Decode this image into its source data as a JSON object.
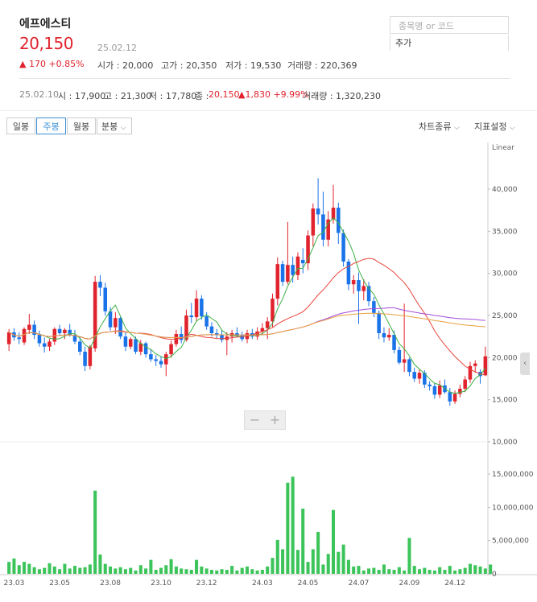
{
  "header": {
    "stock_name": "에프에스티",
    "price": "20,150",
    "date": "25.02.12",
    "change": "▲ 170 +0.85%",
    "open": "시가 : 20,000",
    "high": "고가 : 20,350",
    "low": "저가 : 19,530",
    "volume": "거래량 : 220,369"
  },
  "search": {
    "placeholder": "종목명 or 코드",
    "add_label": "추가"
  },
  "day_info": {
    "date": "25.02.10",
    "open": "시 : 17,900",
    "high": "고 : 21,300",
    "low": "저 : 17,780",
    "close_label": "종 :",
    "close_value": "20,150",
    "change": "▲1,830 +9.99%",
    "volume": "거래량 : 1,320,230"
  },
  "period_buttons": [
    "일봉",
    "주봉",
    "월봉",
    "분봉"
  ],
  "active_period": "주봉",
  "right_menu": {
    "chart_type": "차트종류",
    "indicator": "지표설정"
  },
  "zoom": {
    "minus": "−",
    "plus": "+"
  },
  "colors": {
    "up": "#e0232c",
    "down": "#1a73e8",
    "volume": "#3cc45a",
    "ma5": "#3cb043",
    "ma20": "#e8453c",
    "ma60": "#a34cd8",
    "ma120": "#e8a03c"
  },
  "chart_data": {
    "type": "candlestick",
    "scale_label": "Linear",
    "price_ylim": [
      10000,
      42000
    ],
    "price_ticks": [
      "40,000",
      "35,000",
      "30,000",
      "25,000",
      "20,000",
      "15,000",
      "10,000"
    ],
    "volume_ylim": [
      0,
      16000000
    ],
    "volume_ticks": [
      "15,000,000",
      "10,000,000",
      "5,000,000",
      "0"
    ],
    "x_labels": [
      "23.03",
      "23.05",
      "23.08",
      "23.10",
      "23.12",
      "24.03",
      "24.05",
      "24.07",
      "24.09",
      "24.12"
    ],
    "candles": [
      [
        21600,
        23400,
        20800,
        23000
      ],
      [
        23000,
        23500,
        22000,
        22400
      ],
      [
        22400,
        23000,
        21600,
        22200
      ],
      [
        21800,
        23600,
        21500,
        23400
      ],
      [
        23300,
        25200,
        22800,
        23900
      ],
      [
        23900,
        24400,
        22200,
        22700
      ],
      [
        22700,
        23200,
        21300,
        21700
      ],
      [
        21700,
        22400,
        20600,
        21300
      ],
      [
        21300,
        22200,
        20800,
        21900
      ],
      [
        21900,
        23600,
        21500,
        23400
      ],
      [
        23400,
        23900,
        22600,
        22900
      ],
      [
        22900,
        23500,
        22200,
        23300
      ],
      [
        23300,
        24000,
        22500,
        22700
      ],
      [
        22700,
        23300,
        21600,
        21900
      ],
      [
        21900,
        22500,
        20300,
        20700
      ],
      [
        20700,
        21300,
        18400,
        19000
      ],
      [
        19000,
        21500,
        18600,
        21300
      ],
      [
        21100,
        29700,
        20700,
        29000
      ],
      [
        29000,
        29800,
        27300,
        28300
      ],
      [
        28300,
        28900,
        25000,
        25500
      ],
      [
        25500,
        26000,
        23200,
        23600
      ],
      [
        23600,
        25400,
        22800,
        24700
      ],
      [
        24700,
        24900,
        22200,
        22500
      ],
      [
        22500,
        23000,
        20800,
        21300
      ],
      [
        21300,
        22400,
        21000,
        22200
      ],
      [
        22200,
        22500,
        20400,
        20700
      ],
      [
        20700,
        22100,
        20300,
        21700
      ],
      [
        21700,
        21900,
        20000,
        20400
      ],
      [
        20400,
        21000,
        19500,
        19800
      ],
      [
        19800,
        20300,
        19000,
        19600
      ],
      [
        19600,
        20100,
        18800,
        19200
      ],
      [
        19200,
        20700,
        17800,
        20400
      ],
      [
        20400,
        22000,
        20000,
        21600
      ],
      [
        21600,
        23300,
        21300,
        22800
      ],
      [
        22800,
        23700,
        21700,
        22100
      ],
      [
        22100,
        25700,
        21900,
        25000
      ],
      [
        25000,
        26500,
        24100,
        24800
      ],
      [
        24800,
        28000,
        24300,
        27000
      ],
      [
        27000,
        27400,
        24500,
        24900
      ],
      [
        24900,
        25400,
        23300,
        23700
      ],
      [
        23700,
        24200,
        22500,
        22900
      ],
      [
        22900,
        23400,
        22300,
        22700
      ],
      [
        22700,
        23200,
        21800,
        22100
      ],
      [
        22100,
        23000,
        20300,
        22500
      ],
      [
        22500,
        23300,
        21800,
        22900
      ],
      [
        22900,
        23600,
        22400,
        22600
      ],
      [
        22600,
        23100,
        21900,
        22200
      ],
      [
        22200,
        23300,
        21700,
        22900
      ],
      [
        22900,
        23400,
        22200,
        22500
      ],
      [
        22500,
        23600,
        22100,
        23100
      ],
      [
        23100,
        24100,
        22700,
        23500
      ],
      [
        23500,
        24800,
        22200,
        24300
      ],
      [
        24300,
        27600,
        23600,
        27000
      ],
      [
        27000,
        31900,
        26200,
        31100
      ],
      [
        31100,
        31500,
        28500,
        29000
      ],
      [
        29000,
        36100,
        28700,
        31000
      ],
      [
        31000,
        32000,
        28900,
        29800
      ],
      [
        29800,
        32500,
        29200,
        32000
      ],
      [
        31600,
        33000,
        30000,
        31200
      ],
      [
        31200,
        35100,
        30400,
        34500
      ],
      [
        34500,
        38300,
        33200,
        37700
      ],
      [
        37700,
        41300,
        35800,
        37000
      ],
      [
        37000,
        39700,
        33200,
        34000
      ],
      [
        34000,
        37400,
        33200,
        36400
      ],
      [
        36400,
        40500,
        35900,
        37800
      ],
      [
        37800,
        38400,
        33500,
        34800
      ],
      [
        34800,
        35200,
        30800,
        31400
      ],
      [
        31400,
        31700,
        28000,
        28700
      ],
      [
        28700,
        29800,
        27600,
        29200
      ],
      [
        29200,
        30100,
        24000,
        27900
      ],
      [
        27900,
        29300,
        26800,
        28500
      ],
      [
        28500,
        29000,
        26100,
        26700
      ],
      [
        26700,
        27200,
        24800,
        25300
      ],
      [
        25300,
        25600,
        22200,
        22900
      ],
      [
        22900,
        23600,
        21800,
        22400
      ],
      [
        22400,
        23500,
        22000,
        22700
      ],
      [
        22700,
        23200,
        20500,
        20900
      ],
      [
        20900,
        21300,
        19200,
        19400
      ],
      [
        19400,
        26400,
        18300,
        19800
      ],
      [
        19800,
        20000,
        17800,
        18300
      ],
      [
        18300,
        18800,
        17100,
        17500
      ],
      [
        17500,
        18600,
        16900,
        18200
      ],
      [
        18200,
        18500,
        16400,
        16800
      ],
      [
        16800,
        17200,
        16100,
        16600
      ],
      [
        16600,
        17000,
        15100,
        15600
      ],
      [
        15600,
        17300,
        15200,
        16700
      ],
      [
        16700,
        17400,
        15700,
        15900
      ],
      [
        15900,
        16400,
        14300,
        14800
      ],
      [
        14800,
        16100,
        14500,
        15700
      ],
      [
        15700,
        16800,
        15300,
        16300
      ],
      [
        16300,
        17800,
        15900,
        17400
      ],
      [
        17400,
        19500,
        17000,
        19000
      ],
      [
        19000,
        19700,
        18200,
        19300
      ],
      [
        18300,
        18600,
        16900,
        17800
      ],
      [
        17900,
        21300,
        17800,
        20150
      ]
    ],
    "volumes": [
      1800000,
      2300000,
      1300000,
      1800000,
      1500000,
      1000000,
      700000,
      900000,
      1600000,
      1100000,
      700000,
      1500000,
      800000,
      1200000,
      900000,
      1000000,
      1400000,
      12500000,
      2900000,
      1500000,
      1100000,
      800000,
      1000000,
      700000,
      900000,
      500000,
      1300000,
      800000,
      2100000,
      600000,
      900000,
      1300000,
      2200000,
      1100000,
      800000,
      700000,
      600000,
      2100000,
      1100000,
      800000,
      600000,
      500000,
      700000,
      600000,
      1200000,
      500000,
      900000,
      1100000,
      700000,
      500000,
      600000,
      1100000,
      2400000,
      5100000,
      3700000,
      13700000,
      14600000,
      3600000,
      9800000,
      1800000,
      3700000,
      6300000,
      1400000,
      3000000,
      9600000,
      3300000,
      4400000,
      2100000,
      1100000,
      1200000,
      500000,
      800000,
      900000,
      600000,
      1400000,
      700000,
      600000,
      1000000,
      500000,
      5400000,
      1200000,
      700000,
      900000,
      600000,
      500000,
      1000000,
      600000,
      1200000,
      500000,
      700000,
      900000,
      1500000,
      1300000,
      1100000,
      800000,
      1400000
    ],
    "ma_series": [
      {
        "key": "ma5",
        "period": 5
      },
      {
        "key": "ma20",
        "period": 20
      },
      {
        "key": "ma60",
        "period": 60
      },
      {
        "key": "ma120",
        "period": 120
      }
    ]
  }
}
